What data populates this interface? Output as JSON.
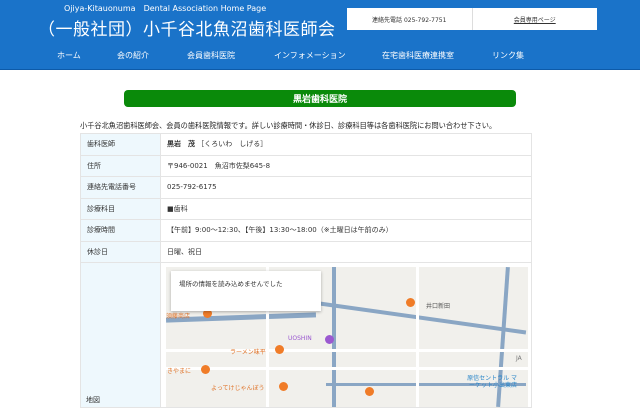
{
  "header": {
    "subtitle": "Ojiya-Kitauonuma　Dental Association Home Page",
    "title": "（一般社団）小千谷北魚沼歯科医師会",
    "contact": "連絡先電話 025-792-7751",
    "members_link": "会員専用ページ"
  },
  "nav": [
    "ホーム",
    "会の紹介",
    "会員歯科医院",
    "インフォメーション",
    "在宅歯科医療連携室",
    "リンク集"
  ],
  "page_title": "黒岩歯科医院",
  "intro": "小千谷北魚沼歯科医師会、会員の歯科医院情報です。詳しい診療時間・休診日、診療科目等は各歯科医院にお問い合わせ下さい。",
  "rows": [
    {
      "label": "歯科医師",
      "name": "黒岩　茂",
      "reading": "［くろいわ　しげる］"
    },
    {
      "label": "住所",
      "value": "〒946-0021　魚沼市佐梨645-8"
    },
    {
      "label": "連絡先電話番号",
      "value": "025-792-6175"
    },
    {
      "label": "診療科目",
      "value": "■歯科"
    },
    {
      "label": "診療時間",
      "value": "【午前】9:00～12:30、【午後】13:30～18:00（※土曜日は午前のみ）"
    },
    {
      "label": "休診日",
      "value": "日曜、祝日"
    },
    {
      "label": "地図"
    }
  ],
  "map": {
    "error": "場所の情報を読み込めませんでした",
    "labels": [
      "須藤商店",
      "井口新田",
      "UOSHIN",
      "ラーメン味平",
      "きやまに",
      "よってけじゃんぼう",
      "原信セントラル マーケット小出東店",
      "JA"
    ]
  }
}
